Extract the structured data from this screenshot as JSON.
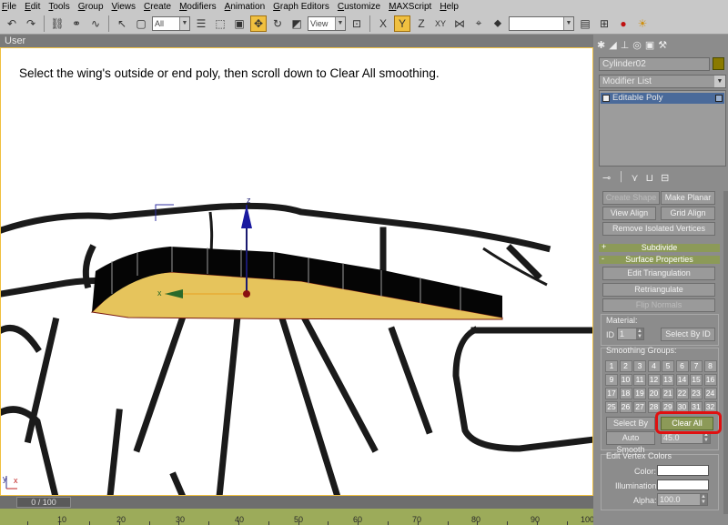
{
  "menu": [
    "File",
    "Edit",
    "Tools",
    "Group",
    "Views",
    "Create",
    "Modifiers",
    "Animation",
    "Graph Editors",
    "Customize",
    "MAXScript",
    "Help"
  ],
  "toolbar": {
    "selection_filter": "All",
    "ref_coord": "View",
    "named_set": ""
  },
  "viewport": {
    "label": "User",
    "instruction": "Select the wing's outside or end poly, then scroll down to Clear All smoothing.",
    "gizmo_z": "z",
    "gizmo_x": "x",
    "axis_y": "y",
    "axis_x": "x"
  },
  "timeline": {
    "frame": "0 / 100",
    "ticks": [
      "10",
      "20",
      "30",
      "40",
      "50",
      "60",
      "70",
      "80",
      "90",
      "100"
    ]
  },
  "panel": {
    "object_name": "Cylinder02",
    "object_color": "#8a7a00",
    "modifier_list": "Modifier List",
    "stack_item": "Editable Poly",
    "buttons": {
      "create_shape": "Create Shape",
      "make_planar": "Make Planar",
      "view_align": "View Align",
      "grid_align": "Grid Align",
      "remove_isolated": "Remove Isolated Vertices",
      "edit_triangulation": "Edit Triangulation",
      "retriangulate": "Retriangulate",
      "flip_normals": "Flip Normals",
      "select_by_id": "Select By ID",
      "select_by_sg": "Select By SG",
      "clear_all": "Clear All",
      "auto_smooth": "Auto Smooth"
    },
    "rollouts": {
      "subdivide": "Subdivide",
      "surface_properties": "Surface Properties"
    },
    "material": {
      "label": "Material:",
      "id_label": "ID",
      "id_value": "1"
    },
    "smoothing": {
      "label": "Smoothing Groups:",
      "groups": [
        "1",
        "2",
        "3",
        "4",
        "5",
        "6",
        "7",
        "8",
        "9",
        "10",
        "11",
        "12",
        "13",
        "14",
        "15",
        "16",
        "17",
        "18",
        "19",
        "20",
        "21",
        "22",
        "23",
        "24",
        "25",
        "26",
        "27",
        "28",
        "29",
        "30",
        "31",
        "32"
      ],
      "auto_smooth_value": "45.0"
    },
    "vertex_colors": {
      "label": "Edit Vertex Colors",
      "color_label": "Color:",
      "illumination_label": "Illumination:",
      "alpha_label": "Alpha:",
      "alpha_value": "100.0"
    }
  },
  "colors": {
    "highlight": "#e01010",
    "rollout_green": "#8c9a58",
    "wing_top": "#000000",
    "wing_side": "#e6c45c"
  }
}
